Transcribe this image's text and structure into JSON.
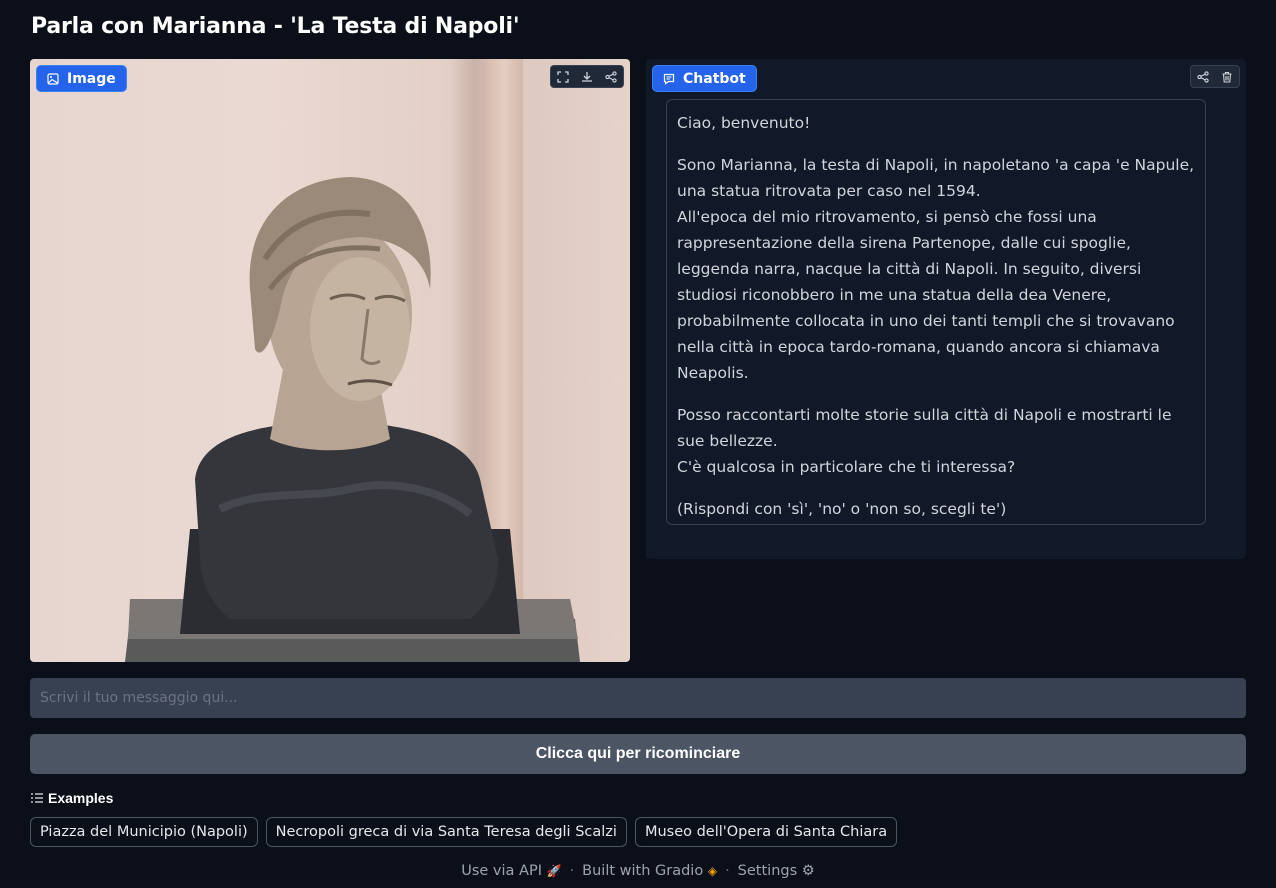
{
  "app": {
    "title": "Parla con Marianna - 'La Testa di Napoli'"
  },
  "image_panel": {
    "label": "Image",
    "tools": [
      "fullscreen-icon",
      "download-icon",
      "share-icon"
    ]
  },
  "chatbot": {
    "label": "Chatbot",
    "tools": [
      "share-icon",
      "trash-icon"
    ],
    "message": {
      "p1": "Ciao, benvenuto!",
      "p2_l1": "Sono Marianna, la testa di Napoli, in napoletano 'a capa 'e Napule, una statua ritrovata per caso nel 1594.",
      "p2_l2": "All'epoca del mio ritrovamento, si pensò che fossi una rappresentazione della sirena Partenope, dalle cui spoglie, leggenda narra, nacque la città di Napoli. In seguito, diversi studiosi riconobbero in me una statua della dea Venere, probabilmente collocata in uno dei tanti templi che si trovavano nella città in epoca tardo-romana, quando ancora si chiamava Neapolis.",
      "p3_l1": "Posso raccontarti molte storie sulla città di Napoli e mostrarti le sue bellezze.",
      "p3_l2": "C'è qualcosa in particolare che ti interessa?",
      "p4": "(Rispondi con 'sì', 'no' o 'non so, scegli te')"
    }
  },
  "input": {
    "placeholder": "Scrivi il tuo messaggio qui...",
    "value": ""
  },
  "restart_button": {
    "label": "Clicca qui per ricominciare"
  },
  "examples": {
    "label": "Examples",
    "items": [
      "Piazza del Municipio (Napoli)",
      "Necropoli greca di via Santa Teresa degli Scalzi",
      "Museo dell'Opera di Santa Chiara"
    ]
  },
  "footer": {
    "api": "Use via API",
    "built": "Built with Gradio",
    "settings": "Settings"
  },
  "colors": {
    "background": "#0b0f19",
    "panel": "#111827",
    "accent": "#2563eb",
    "button": "#4b5563"
  }
}
